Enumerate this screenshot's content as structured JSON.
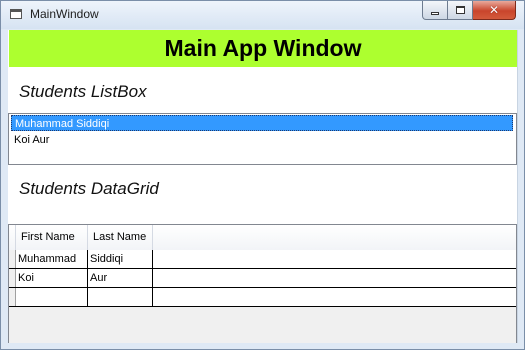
{
  "window": {
    "title": "MainWindow"
  },
  "header": {
    "title": "Main App Window",
    "background": "#adff2f"
  },
  "listbox_section": {
    "label": "Students ListBox",
    "items": [
      {
        "text": "Muhammad Siddiqi",
        "selected": true
      },
      {
        "text": "Koi Aur",
        "selected": false
      }
    ],
    "selection_color": "#3399ff"
  },
  "datagrid_section": {
    "label": "Students DataGrid",
    "columns": [
      "First Name",
      "Last Name"
    ],
    "rows": [
      [
        "Muhammad",
        "Siddiqi"
      ],
      [
        "Koi",
        "Aur"
      ],
      [
        "",
        ""
      ]
    ]
  },
  "icons": {
    "minimize": "minimize-icon",
    "maximize": "maximize-icon",
    "close": "close-icon"
  }
}
